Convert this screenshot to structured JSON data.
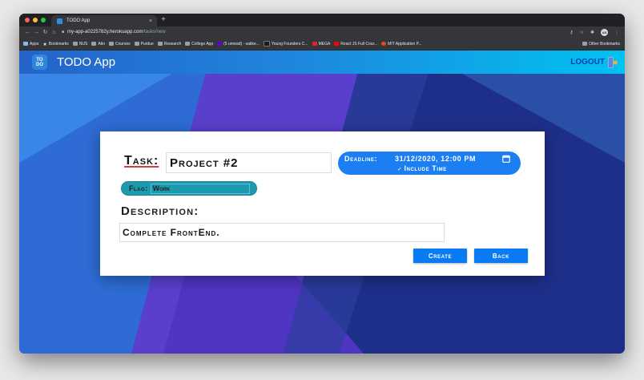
{
  "browser": {
    "tab_title": "TODO App",
    "tab_close": "×",
    "new_tab": "+",
    "url_host": "my-app-a0225782y.herokuapp.com",
    "url_path": "/tasks/new",
    "profile_initials": "AS",
    "bookmarks": [
      {
        "label": "Apps",
        "icon": "apps-icon"
      },
      {
        "label": "Bookmarks",
        "icon": "star-icon"
      },
      {
        "label": "NUS",
        "icon": "folder-icon"
      },
      {
        "label": "Atin",
        "icon": "folder-icon"
      },
      {
        "label": "Courses",
        "icon": "folder-icon"
      },
      {
        "label": "Purdue",
        "icon": "folder-icon"
      },
      {
        "label": "Research",
        "icon": "folder-icon"
      },
      {
        "label": "College App",
        "icon": "folder-icon"
      },
      {
        "label": "(5 unread) - sakke...",
        "icon": "yahoo-icon"
      },
      {
        "label": "Young Founders C...",
        "icon": "yf-icon"
      },
      {
        "label": "MEGA",
        "icon": "mega-icon"
      },
      {
        "label": "React JS Full Cour...",
        "icon": "youtube-icon"
      },
      {
        "label": "MIT Application P...",
        "icon": "mit-icon"
      }
    ],
    "other_bookmarks": "Other Bookmarks"
  },
  "app": {
    "logo_line1": "TO",
    "logo_line2": "DO",
    "title": "TODO App",
    "logout": "LOGOUT"
  },
  "form": {
    "task_label": "Task:",
    "task_value": "Project #2",
    "deadline_label": "Deadline:",
    "deadline_value": "31/12/2020, 12:00 PM",
    "include_time": "Include Time",
    "flag_label": "Flag:",
    "flag_value": "Work",
    "description_label": "Description:",
    "description_value": "Complete FrontEnd.",
    "create_button": "Create",
    "back_button": "Back"
  },
  "colors": {
    "appbar_start": "#2563c9",
    "appbar_end": "#00c2f2",
    "primary_button": "#0a7bf2",
    "deadline_pill": "#1b7ef2",
    "flag_pill": "#1e9ab0",
    "task_underline": "#e0383e"
  }
}
